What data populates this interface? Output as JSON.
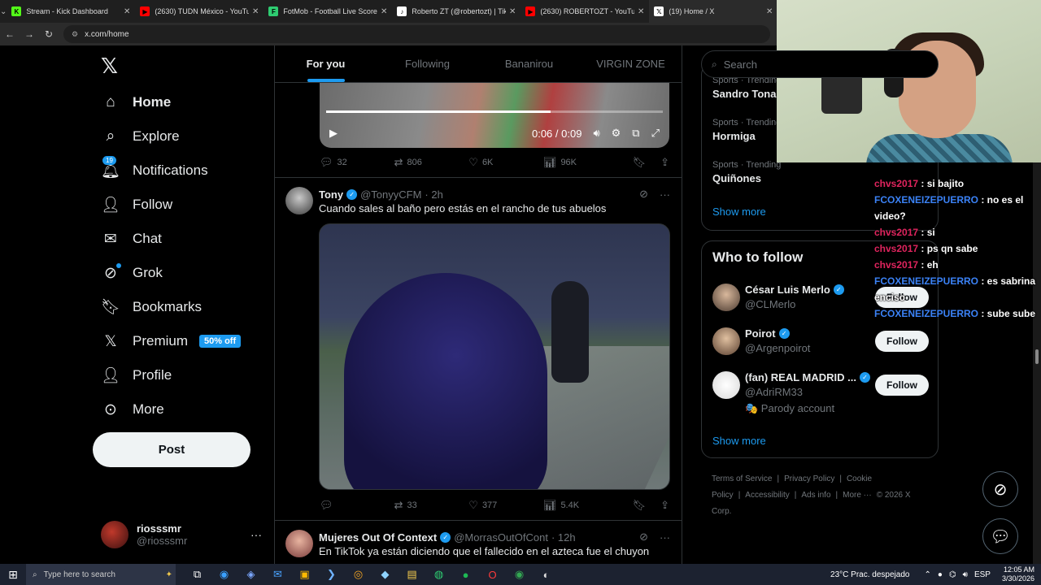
{
  "browser": {
    "tabs": [
      {
        "title": "Stream - Kick Dashboard",
        "icon": "kick-icon",
        "color": "#53fc18",
        "glyph": "K"
      },
      {
        "title": "(2630) TUDN México - YouTube",
        "icon": "youtube-icon",
        "color": "#ff0000",
        "glyph": "▶"
      },
      {
        "title": "FotMob - Football Live Scores",
        "icon": "fotmob-icon",
        "color": "#2ecc71",
        "glyph": "F"
      },
      {
        "title": "Roberto ZT (@robertozt) | TikTok",
        "icon": "tiktok-icon",
        "color": "#ffffff",
        "glyph": "♪"
      },
      {
        "title": "(2630) ROBERTOZT - YouTube",
        "icon": "youtube-icon",
        "color": "#ff0000",
        "glyph": "▶"
      },
      {
        "title": "(19) Home / X",
        "icon": "x-icon",
        "color": "#ffffff",
        "glyph": "𝕏"
      }
    ],
    "active_tab_index": 5,
    "url": "x.com/home"
  },
  "leftnav": {
    "logo": "𝕏",
    "items": [
      {
        "label": "Home",
        "icon": "home-icon",
        "glyph": "⌂"
      },
      {
        "label": "Explore",
        "icon": "search-icon",
        "glyph": "⌕"
      },
      {
        "label": "Notifications",
        "icon": "bell-icon",
        "glyph": "🔔︎",
        "badge": "19"
      },
      {
        "label": "Follow",
        "icon": "add-person-icon",
        "glyph": "👤︎"
      },
      {
        "label": "Chat",
        "icon": "mail-icon",
        "glyph": "✉"
      },
      {
        "label": "Grok",
        "icon": "grok-icon",
        "glyph": "⊘"
      },
      {
        "label": "Bookmarks",
        "icon": "bookmark-icon",
        "glyph": "🔖︎"
      },
      {
        "label": "Premium",
        "icon": "x-premium-icon",
        "glyph": "𝕏",
        "badge": "50% off"
      },
      {
        "label": "Profile",
        "icon": "profile-icon",
        "glyph": "👤︎"
      },
      {
        "label": "More",
        "icon": "more-circle-icon",
        "glyph": "⊙"
      }
    ],
    "post_label": "Post",
    "account": {
      "display_name": "riosssmr",
      "handle": "@riosssmr",
      "more": "···"
    }
  },
  "center": {
    "tabs": [
      "For you",
      "Following",
      "Bananirou",
      "VIRGIN ZONE"
    ],
    "active_tab": 0,
    "tweet1": {
      "video_time": "0:06 / 0:09",
      "video_progress": 0.667,
      "replies": "32",
      "reposts": "806",
      "likes": "6K",
      "views": "96K"
    },
    "tweet2": {
      "display_name": "Tony",
      "handle": "@TonyyCFM",
      "time": "· 2h",
      "text": "Cuando sales al baño pero estás en el rancho de tus abuelos",
      "replies": "",
      "reposts": "33",
      "likes": "377",
      "views": "5.4K"
    },
    "tweet3": {
      "display_name": "Mujeres Out Of Context",
      "handle": "@MorrasOutOfCont",
      "time": "· 12h",
      "text": "En TikTok ya están diciendo que el fallecido en el azteca fue el chuyon"
    }
  },
  "right": {
    "search_placeholder": "Search",
    "trends": [
      {
        "category": "Sports · Trending",
        "name": "Sandro Tona"
      },
      {
        "category": "Sports · Trending",
        "name": "Hormiga"
      },
      {
        "category": "Sports · Trending",
        "name": "Quiñones"
      }
    ],
    "trends_show_more": "Show more",
    "who_to_follow_title": "Who to follow",
    "suggestions": [
      {
        "display_name": "César Luis Merlo",
        "handle": "@CLMerlo",
        "verified": true,
        "follow_label": "Follow"
      },
      {
        "display_name": "Poirot",
        "handle": "@Argenpoirot",
        "verified": true,
        "follow_label": "Follow"
      },
      {
        "display_name": "(fan) REAL MADRID ...",
        "handle": "@AdriRM33",
        "verified": true,
        "follow_label": "Follow",
        "note": "🎭 Parody account"
      }
    ],
    "wtf_show_more": "Show more",
    "footer": [
      "Terms of Service",
      "|",
      "Privacy Policy",
      "|",
      "Cookie Policy",
      "|",
      "Accessibility",
      "|",
      "Ads info",
      "|",
      "More ···",
      "© 2026 X Corp."
    ]
  },
  "chat": [
    {
      "user": "chvs2017",
      "text": " : si bajito",
      "color": "u1"
    },
    {
      "user": "FCOXENEIZEPUERRO",
      "text": " : no es el video?",
      "color": "u2"
    },
    {
      "user": "chvs2017",
      "text": " : si",
      "color": "u1"
    },
    {
      "user": "chvs2017",
      "text": " : ps qn sabe",
      "color": "u1"
    },
    {
      "user": "chvs2017",
      "text": " : eh",
      "color": "u1"
    },
    {
      "user": "FCOXENEIZEPUERRO",
      "text": " : es sabrina enciso",
      "color": "u2"
    },
    {
      "user": "FCOXENEIZEPUERRO",
      "text": " : sube sube",
      "color": "u2"
    }
  ],
  "taskbar": {
    "search_placeholder": "Type here to search",
    "weather": "23°C  Prac. despejado",
    "lang": "ESP",
    "time": "12:05 AM",
    "date": "3/30/2026"
  }
}
